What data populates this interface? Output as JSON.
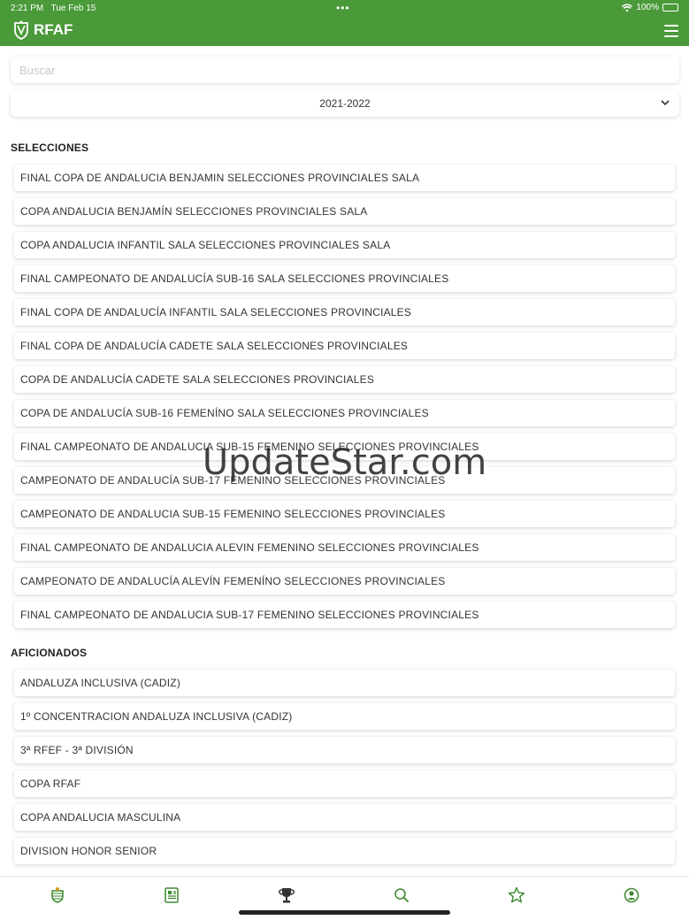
{
  "status_bar": {
    "time": "2:21 PM",
    "date": "Tue Feb 15",
    "battery": "100%"
  },
  "header": {
    "logo_text": "RFAF"
  },
  "search": {
    "placeholder": "Buscar"
  },
  "season": {
    "selected": "2021-2022"
  },
  "sections": {
    "selecciones": {
      "title": "SELECCIONES",
      "items": [
        "FINAL COPA DE ANDALUCIA BENJAMIN SELECCIONES PROVINCIALES SALA",
        "COPA ANDALUCIA BENJAMÍN SELECCIONES PROVINCIALES SALA",
        "COPA ANDALUCIA INFANTIL SALA SELECCIONES PROVINCIALES SALA",
        "FINAL CAMPEONATO DE ANDALUCÍA SUB-16 SALA SELECCIONES PROVINCIALES",
        "FINAL COPA DE ANDALUCÍA INFANTIL SALA SELECCIONES PROVINCIALES",
        "FINAL COPA DE ANDALUCÍA CADETE SALA SELECCIONES PROVINCIALES",
        "COPA DE ANDALUCÍA CADETE SALA SELECCIONES PROVINCIALES",
        "COPA DE ANDALUCÍA SUB-16 FEMENÍNO SALA SELECCIONES PROVINCIALES",
        "FINAL CAMPEONATO DE ANDALUCIA SUB-15 FEMENINO SELECCIONES PROVINCIALES",
        "CAMPEONATO DE ANDALUCÍA SUB-17 FEMENINO SELECCIONES PROVINCIALES",
        "CAMPEONATO DE ANDALUCIA SUB-15 FEMENINO SELECCIONES PROVINCIALES",
        "FINAL CAMPEONATO DE ANDALUCIA ALEVIN FEMENINO SELECCIONES PROVINCIALES",
        "CAMPEONATO DE ANDALUCÍA ALEVÍN FEMENÍNO SELECCIONES PROVINCIALES",
        "FINAL CAMPEONATO DE ANDALUCIA SUB-17 FEMENINO SELECCIONES PROVINCIALES"
      ]
    },
    "aficionados": {
      "title": "AFICIONADOS",
      "items": [
        "ANDALUZA INCLUSIVA (CADIZ)",
        "1º CONCENTRACION ANDALUZA INCLUSIVA (CADIZ)",
        "3ª RFEF - 3ª DIVISIÓN",
        "COPA RFAF",
        "COPA ANDALUCIA MASCULINA",
        "DIVISION HONOR SENIOR"
      ]
    }
  },
  "watermark": "UpdateStar.com",
  "tabs": [
    "club-crest-icon",
    "news-icon",
    "trophy-icon",
    "search-icon",
    "star-icon",
    "profile-icon"
  ],
  "colors": {
    "brand_green": "#4a9a3a",
    "icon_green": "#3c8a2e"
  }
}
